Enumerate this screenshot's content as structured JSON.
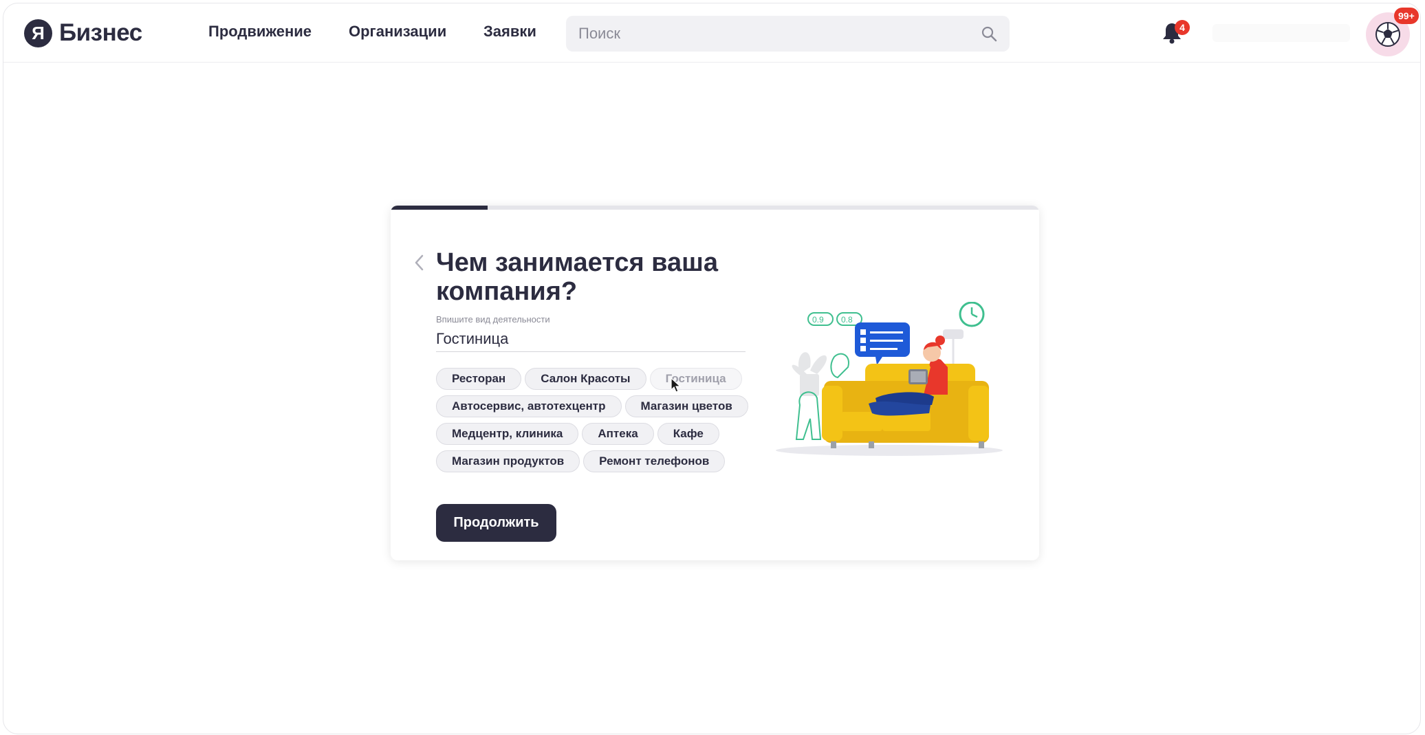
{
  "header": {
    "logo_mark": "Я",
    "logo_text": "Бизнес",
    "nav": [
      "Продвижение",
      "Организации",
      "Заявки"
    ],
    "search_placeholder": "Поиск",
    "notifications_count": "4",
    "avatar_badge": "99+"
  },
  "onboarding": {
    "progress_percent": 15,
    "title": "Чем занимается ваша компания?",
    "field_label": "Впишите вид деятельности",
    "field_value": "Гостиница",
    "chips": [
      [
        "Ресторан",
        "Салон Красоты",
        "Гостиница"
      ],
      [
        "Автосервис, автотехцентр",
        "Магазин цветов"
      ],
      [
        "Медцентр, клиника",
        "Аптека",
        "Кафе"
      ],
      [
        "Магазин продуктов",
        "Ремонт телефонов"
      ]
    ],
    "active_chip": "Гостиница",
    "continue_label": "Продолжить",
    "illustration_labels": [
      "0.9",
      "0.8"
    ]
  },
  "colors": {
    "primary": "#2c2c40",
    "badge": "#e8372b",
    "accent_green": "#3fbf8f",
    "sofa_yellow": "#f3c316"
  }
}
